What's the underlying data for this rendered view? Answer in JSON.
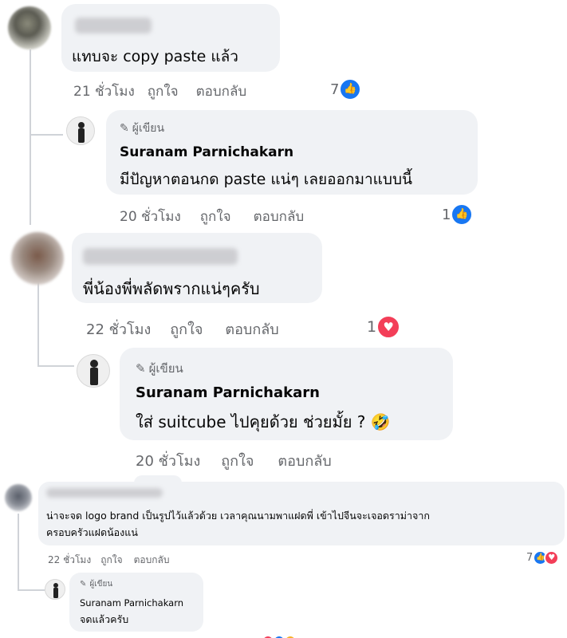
{
  "meta_labels": {
    "like": "ถูกใจ",
    "reply": "ตอบกลับ"
  },
  "author_badge": "ผู้เขียน",
  "colors": {
    "bubble": "#f0f2f5",
    "like": "#1877f2",
    "love": "#f33e58",
    "meta": "#65676b"
  },
  "comments": [
    {
      "text": "แทบจะ copy paste แล้ว",
      "time": "21 ชั่วโมง",
      "reaction_count": "7",
      "reaction_icon": "like-icon"
    },
    {
      "author": "Suranam Parnichakarn",
      "text": "มีปัญหาตอนกด paste แน่ๆ เลยออกมาแบบนี้",
      "time": "20 ชั่วโมง",
      "reaction_count": "1",
      "reaction_icon": "like-icon"
    },
    {
      "text": "พี่น้องพี่พลัดพรากแน่ๆครับ",
      "time": "22 ชั่วโมง",
      "reaction_count": "1",
      "reaction_icon": "love-icon"
    },
    {
      "author": "Suranam Parnichakarn",
      "text": "ใส่ suitcube ไปคุยด้วย ช่วยมั้ย ? 🤣",
      "time": "20 ชั่วโมง"
    },
    {
      "text_line1": "น่าจะจด logo brand เป็นรูปไว้แล้วด้วย เวลาคุณนามพาแฝดพี่ เข้าไปจีนจะเจอดราม่าจาก",
      "text_line2": "ครอบครัวแฝดน้องแน่",
      "time": "22 ชั่วโมง",
      "reaction_count": "7",
      "reaction_icons": [
        "like-icon",
        "love-icon"
      ]
    },
    {
      "author": "Suranam Parnichakarn",
      "text": "จดแล้วครับ"
    }
  ]
}
